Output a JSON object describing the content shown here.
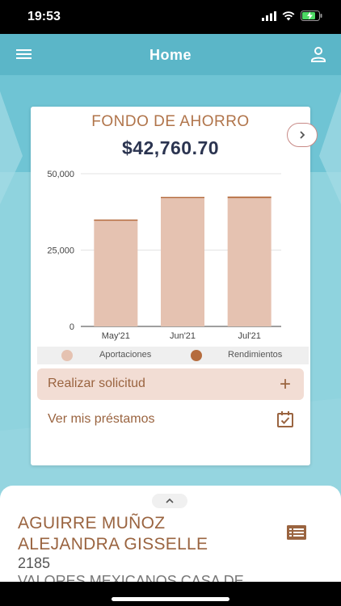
{
  "status_bar": {
    "time": "19:53"
  },
  "app_bar": {
    "title": "Home"
  },
  "fund_card": {
    "title": "FONDO DE AHORRO",
    "amount": "$42,760.70"
  },
  "chart_data": {
    "type": "bar",
    "categories": [
      "May'21",
      "Jun'21",
      "Jul'21"
    ],
    "series": [
      {
        "name": "Aportaciones",
        "values": [
          34800,
          42000,
          42000
        ]
      },
      {
        "name": "Rendimientos",
        "values": [
          200,
          400,
          500
        ]
      }
    ],
    "stacked": true,
    "ylim": [
      0,
      50000
    ],
    "yticks": [
      0,
      25000,
      50000
    ],
    "ytick_labels": [
      "0",
      "25,000",
      "50,000"
    ],
    "grid": true,
    "legend": "bottom",
    "colors": {
      "Aportaciones": "#e5c2b1",
      "Rendimientos": "#b56c3e"
    }
  },
  "legend": {
    "items": [
      "Aportaciones",
      "Rendimientos"
    ]
  },
  "actions": {
    "request_label": "Realizar solicitud",
    "request_icon": "+",
    "loans_label": "Ver mis préstamos"
  },
  "bottom_sheet": {
    "name_line1": "AGUIRRE MUÑOZ",
    "name_line2": "ALEJANDRA GISSELLE",
    "number": "2185",
    "company": "VALORES MEXICANOS CASA DE"
  }
}
